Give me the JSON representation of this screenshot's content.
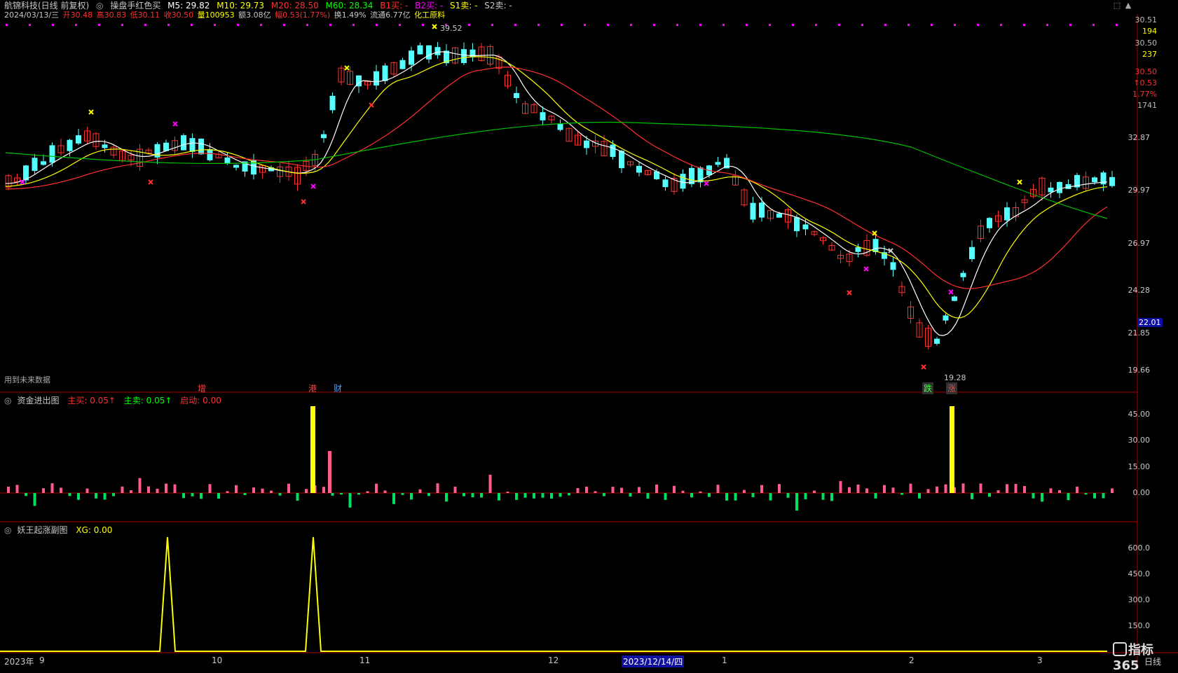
{
  "header": {
    "stock_name": "航锦科技(日线 前复权)",
    "indicator_name": "操盘手红色买",
    "ma": [
      {
        "label": "M5: 29.82",
        "color": "#ffffff"
      },
      {
        "label": "M10: 29.73",
        "color": "#ffff00"
      },
      {
        "label": "M20: 28.50",
        "color": "#ff3030"
      },
      {
        "label": "M60: 28.34",
        "color": "#00ff00"
      }
    ],
    "signals": [
      {
        "label": "B1买: -",
        "color": "#ff3030"
      },
      {
        "label": "B2买: -",
        "color": "#ff00ff"
      },
      {
        "label": "S1卖: -",
        "color": "#ffff00"
      },
      {
        "label": "S2卖: -",
        "color": "#c8c8c8"
      }
    ],
    "quote": {
      "date": "2024/03/13/三",
      "open": "开30.48",
      "high": "高30.83",
      "low": "低30.11",
      "close": "收30.50",
      "volume": "量100953",
      "amount": "额3.08亿",
      "amp": "幅0.53(1.77%)",
      "turnover": "换1.49%",
      "float": "流通6.77亿",
      "sector": "化工原料"
    }
  },
  "main_chart": {
    "note": "用到未来数据",
    "high_label": "39.52",
    "low_label": "19.28",
    "last_price_tag": "22.01",
    "price_axis": [
      "32.87",
      "29.97",
      "26.97",
      "24.28",
      "21.85",
      "19.66"
    ],
    "events": [
      {
        "text": "增",
        "color": "#ff4040",
        "bg": "#000"
      },
      {
        "text": "港",
        "color": "#ff4040",
        "bg": "#000"
      },
      {
        "text": "财",
        "color": "#40a0ff",
        "bg": "#000"
      },
      {
        "text": "跌",
        "color": "#40ff40",
        "bg": "#303030"
      },
      {
        "text": "涨",
        "color": "#ff4040",
        "bg": "#303030"
      }
    ]
  },
  "right_panel": {
    "rows": [
      {
        "text": "30.51",
        "color": "#ffffff"
      },
      {
        "text": "194",
        "color": "#ffff00"
      },
      {
        "text": "30.50",
        "color": "#ffffff"
      },
      {
        "text": "237",
        "color": "#ffff00"
      },
      {
        "text": "30.50",
        "color": "#ff3030"
      },
      {
        "text": "↑0.53",
        "color": "#ff3030"
      },
      {
        "text": "1.77%",
        "color": "#ff3030"
      },
      {
        "text": "1741",
        "color": "#ffffff"
      }
    ]
  },
  "panel2": {
    "title": "资金进出图",
    "items": [
      {
        "label": "主买: 0.05↑",
        "color": "#ff3030"
      },
      {
        "label": "主卖: 0.05↑",
        "color": "#00ff00"
      },
      {
        "label": "启动: 0.00",
        "color": "#ff3030"
      }
    ],
    "axis": [
      "45.00",
      "30.00",
      "15.00",
      "0.00"
    ]
  },
  "panel3": {
    "title": "妖王起涨副图",
    "items": [
      {
        "label": "XG: 0.00",
        "color": "#ffff00"
      }
    ],
    "axis": [
      "600.0",
      "450.0",
      "300.0",
      "150.0"
    ]
  },
  "x_axis": {
    "labels": [
      "2023年",
      "9",
      "10",
      "11",
      "12",
      "2023/12/14/四",
      "1",
      "2",
      "3"
    ],
    "period": "日线"
  },
  "brand": "指标365",
  "colors": {
    "up": "#ff3030",
    "down": "#54ffff",
    "ma5": "#ffffff",
    "ma10": "#ffff00",
    "ma20": "#ff3030",
    "ma60": "#00c000"
  }
}
